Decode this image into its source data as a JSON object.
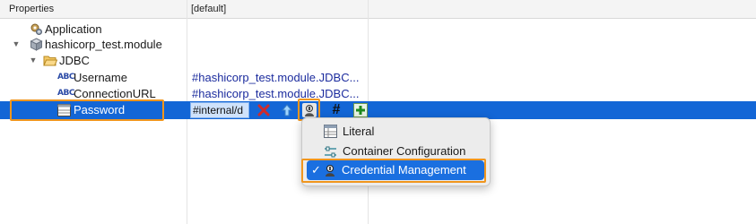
{
  "header": {
    "col_properties": "Properties",
    "col_default": "[default]"
  },
  "tree": {
    "application": "Application",
    "module": "hashicorp_test.module",
    "jdbc": "JDBC",
    "username": {
      "label": "Username",
      "value": "#hashicorp_test.module.JDBC..."
    },
    "connection_url": {
      "label": "ConnectionURL",
      "value": "#hashicorp_test.module.JDBC..."
    },
    "password": {
      "label": "Password",
      "value": "#internal/d"
    }
  },
  "icons": {
    "abc_glyph": "ABC",
    "hash_glyph": "#",
    "delete": "x-icon",
    "up": "up-arrow-icon",
    "credential": "credential-icon",
    "add": "add-icon"
  },
  "menu": {
    "items": [
      {
        "label": "Literal",
        "checked": false
      },
      {
        "label": "Container Configuration",
        "checked": false
      },
      {
        "label": "Credential Management",
        "checked": true
      }
    ],
    "check_glyph": "✓"
  },
  "colors": {
    "selection": "#1366d6",
    "highlight": "#f0961e",
    "value_text": "#1c2c9e",
    "menu_selection": "#1a6fe0"
  }
}
